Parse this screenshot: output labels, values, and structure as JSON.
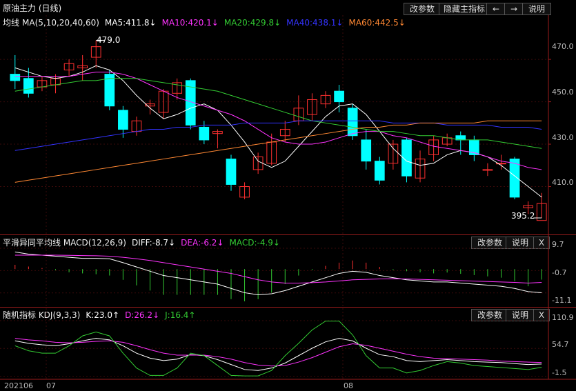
{
  "header": {
    "title": "原油主力 (日线)",
    "buttons": [
      "改参数",
      "隐藏主指标",
      "←",
      "→",
      "说明"
    ]
  },
  "main_legend": {
    "ma_label": "均线",
    "ma_params": "MA(5,10,20,40,60)",
    "items": [
      {
        "text": "MA5:411.8↓",
        "color": "#ffffff"
      },
      {
        "text": "MA10:420.1↓",
        "color": "#ff33ff"
      },
      {
        "text": "MA20:429.8↓",
        "color": "#33cc33"
      },
      {
        "text": "MA40:438.1↓",
        "color": "#3333ff"
      },
      {
        "text": "MA60:442.5↓",
        "color": "#ff8833"
      }
    ],
    "annotations": {
      "high": "479.0",
      "low": "395.2"
    },
    "y_ticks": [
      "470.0",
      "450.0",
      "430.0",
      "410.0"
    ]
  },
  "macd_pane": {
    "title": "平滑异同平均线 MACD(12,26,9)",
    "items": [
      {
        "text": "DIFF:-8.7↓",
        "color": "#ffffff"
      },
      {
        "text": "DEA:-6.2↓",
        "color": "#ff33ff"
      },
      {
        "text": "MACD:-4.9↓",
        "color": "#33cc33"
      }
    ],
    "buttons": [
      "改参数",
      "说明",
      "X"
    ],
    "y_ticks": [
      "9.7",
      "-0.7",
      "-11.1"
    ]
  },
  "kdj_pane": {
    "title": "随机指标 KDJ(9,3,3)",
    "items": [
      {
        "text": "K:23.0↑",
        "color": "#ffffff"
      },
      {
        "text": "D:26.2↓",
        "color": "#ff33ff"
      },
      {
        "text": "J:16.4↑",
        "color": "#33cc33"
      }
    ],
    "buttons": [
      "改参数",
      "说明",
      "X"
    ],
    "y_ticks": [
      "110.9",
      "54.7",
      "-1.5"
    ]
  },
  "x_axis": {
    "labels": [
      "202106",
      "07",
      "08"
    ]
  },
  "colors": {
    "up": "#ff3030",
    "down": "#00ffff",
    "grid": "#3a0a0a",
    "border": "#9b1c1c"
  },
  "chart_data": {
    "type": "candlestick",
    "candles": [
      [
        463,
        460,
        472,
        456
      ],
      [
        461,
        454,
        466,
        452
      ],
      [
        457,
        460,
        462,
        455
      ],
      [
        458,
        461,
        463,
        454
      ],
      [
        465,
        468,
        470,
        462
      ],
      [
        466,
        467,
        472,
        460
      ],
      [
        471,
        476,
        479,
        466
      ],
      [
        463,
        448,
        465,
        446
      ],
      [
        446,
        437,
        448,
        433
      ],
      [
        436,
        441,
        443,
        434
      ],
      [
        448,
        449,
        451,
        444
      ],
      [
        445,
        455,
        456,
        442
      ],
      [
        454,
        459,
        461,
        451
      ],
      [
        460,
        439,
        461,
        437
      ],
      [
        438,
        432,
        441,
        430
      ],
      [
        435,
        436,
        437,
        428
      ],
      [
        423,
        411,
        425,
        408
      ],
      [
        405,
        410,
        412,
        404
      ],
      [
        418,
        424,
        426,
        416
      ],
      [
        421,
        431,
        435,
        420
      ],
      [
        434,
        437,
        441,
        431
      ],
      [
        441,
        447,
        453,
        439
      ],
      [
        444,
        451,
        454,
        441
      ],
      [
        449,
        453,
        455,
        447
      ],
      [
        455,
        450,
        458,
        445
      ],
      [
        447,
        434,
        449,
        432
      ],
      [
        432,
        422,
        437,
        418
      ],
      [
        422,
        413,
        424,
        411
      ],
      [
        421,
        430,
        432,
        418
      ],
      [
        432,
        415,
        433,
        412
      ],
      [
        414,
        423,
        427,
        412
      ],
      [
        425,
        432,
        434,
        422
      ],
      [
        430,
        433,
        435,
        429
      ],
      [
        434,
        432,
        436,
        425
      ],
      [
        432,
        425,
        434,
        422
      ],
      [
        418,
        418,
        421,
        415
      ],
      [
        421,
        421,
        425,
        418
      ],
      [
        423,
        405,
        424,
        404
      ],
      [
        400,
        401,
        403,
        397
      ],
      [
        394,
        402,
        407,
        395.2
      ]
    ],
    "series": [
      {
        "name": "MA5",
        "values": [
          466,
          464,
          462,
          461,
          462,
          464,
          467,
          465,
          460,
          453,
          447,
          442,
          444,
          447,
          449,
          446,
          439,
          431,
          422,
          419,
          422,
          429,
          436,
          443,
          448,
          449,
          444,
          436,
          428,
          422,
          420,
          421,
          425,
          427,
          426,
          424,
          420,
          415,
          410,
          405
        ]
      },
      {
        "name": "MA10",
        "values": [
          462,
          462,
          462,
          462,
          462,
          463,
          464,
          464,
          463,
          461,
          458,
          455,
          452,
          450,
          448,
          446,
          444,
          441,
          437,
          433,
          431,
          430,
          430,
          431,
          433,
          435,
          436,
          436,
          434,
          433,
          431,
          429,
          428,
          427,
          426,
          424,
          422,
          421,
          419,
          418
        ]
      },
      {
        "name": "MA20",
        "values": [
          455,
          456,
          457,
          458,
          459,
          460,
          460,
          461,
          461,
          461,
          460,
          459,
          458,
          457,
          456,
          455,
          453,
          451,
          449,
          447,
          445,
          443,
          441,
          440,
          439,
          438,
          437,
          436,
          436,
          435,
          434,
          434,
          433,
          432,
          432,
          432,
          431,
          430,
          429,
          428
        ]
      },
      {
        "name": "MA40",
        "values": [
          427,
          428,
          429,
          430,
          431,
          432,
          433,
          434,
          435,
          436,
          437,
          437,
          438,
          438,
          439,
          439,
          439,
          440,
          440,
          440,
          440,
          441,
          441,
          441,
          441,
          441,
          441,
          441,
          440,
          440,
          440,
          440,
          439,
          439,
          439,
          439,
          438,
          438,
          438,
          437
        ]
      },
      {
        "name": "MA60",
        "values": [
          412,
          413,
          414,
          415,
          416,
          417,
          418,
          419,
          420,
          421,
          422,
          423,
          424,
          425,
          426,
          427,
          428,
          429,
          430,
          431,
          432,
          433,
          434,
          435,
          436,
          437,
          438,
          438,
          439,
          439,
          440,
          440,
          440,
          440,
          440,
          441,
          441,
          441,
          441,
          441
        ]
      }
    ],
    "macd": {
      "diff": [
        8,
        7,
        6.5,
        6,
        5.5,
        5,
        5,
        4.8,
        3,
        1,
        -1,
        -3,
        -4,
        -5,
        -6,
        -7,
        -9,
        -11,
        -12,
        -11.5,
        -10,
        -8,
        -6,
        -4,
        -2,
        -1,
        -1.5,
        -3,
        -4,
        -5,
        -5.5,
        -6,
        -6,
        -6.5,
        -7,
        -7.5,
        -8,
        -9,
        -10.5,
        -11
      ],
      "dea": [
        6.5,
        6.5,
        6.5,
        6.5,
        6.4,
        6.3,
        6.2,
        6,
        5.5,
        4.8,
        4,
        3,
        2,
        1,
        0,
        -1,
        -2,
        -3.5,
        -5,
        -6,
        -6.5,
        -6.5,
        -6.3,
        -6,
        -5.5,
        -5,
        -4.8,
        -4.6,
        -4.5,
        -4.6,
        -4.8,
        -5,
        -5.2,
        -5.4,
        -5.6,
        -5.8,
        -6,
        -6.2,
        -6.5,
        -6.2
      ],
      "bars": [
        2,
        1.2,
        0.5,
        -0.5,
        -1.5,
        -2,
        -2.4,
        -3,
        -5,
        -7.6,
        -10,
        -12,
        -12,
        -12,
        -12,
        -12,
        -14,
        -15,
        -14,
        -11,
        -7,
        -3,
        -0.5,
        1.5,
        3,
        4,
        3,
        1,
        -0.5,
        -1,
        -1.5,
        -2,
        -1.6,
        -2.2,
        -2.8,
        -3.4,
        -4,
        -5.6,
        -8,
        -4.9
      ]
    },
    "kdj": {
      "k": [
        70,
        65,
        62,
        60,
        64,
        70,
        75,
        72,
        60,
        45,
        35,
        30,
        33,
        42,
        40,
        32,
        22,
        12,
        10,
        15,
        25,
        40,
        55,
        68,
        75,
        70,
        55,
        42,
        38,
        30,
        28,
        30,
        32,
        30,
        28,
        27,
        26,
        24,
        22,
        23
      ],
      "d": [
        75,
        72,
        70,
        67,
        66,
        67,
        69,
        70,
        67,
        60,
        52,
        45,
        41,
        41,
        41,
        38,
        33,
        26,
        21,
        19,
        20,
        27,
        36,
        47,
        58,
        64,
        61,
        55,
        49,
        43,
        38,
        35,
        34,
        33,
        32,
        31,
        29,
        28,
        27,
        26.2
      ],
      "j": [
        60,
        50,
        45,
        45,
        60,
        80,
        88,
        80,
        45,
        15,
        0,
        0,
        15,
        45,
        40,
        20,
        0,
        -1,
        -1,
        10,
        40,
        65,
        92,
        110,
        110,
        82,
        40,
        15,
        15,
        5,
        10,
        20,
        28,
        25,
        20,
        18,
        16,
        14,
        12,
        16.4
      ]
    },
    "main_ylim": [
      390,
      485
    ],
    "macd_ylim": [
      -16,
      11
    ],
    "kdj_ylim": [
      -5,
      115
    ]
  }
}
